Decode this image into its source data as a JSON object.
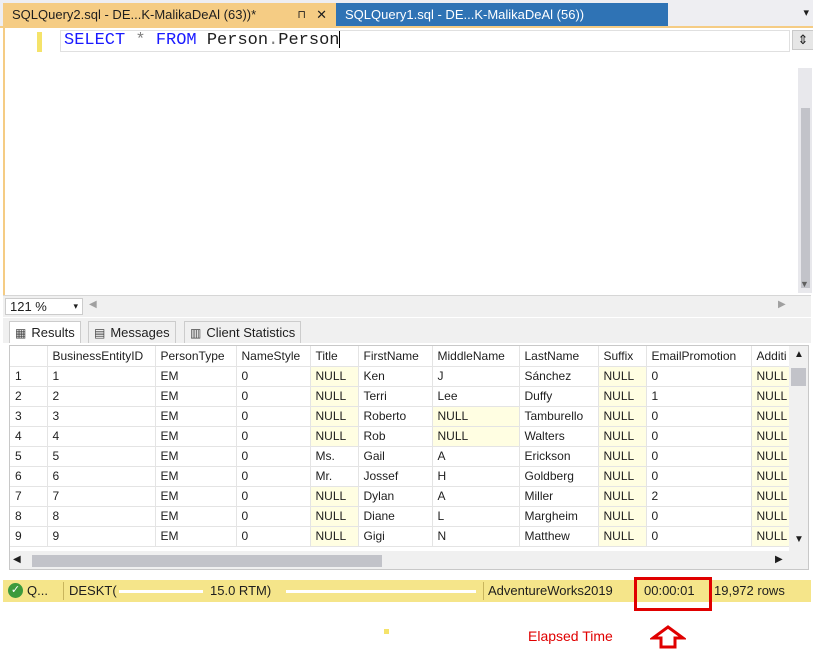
{
  "tabs": [
    {
      "label": "SQLQuery2.sql - DE...K-MalikaDeAl (63))*",
      "pin": "⊓",
      "close": "✕"
    },
    {
      "label": "SQLQuery1.sql - DE...K-MalikaDeAl (56))"
    }
  ],
  "tab_overflow": "▾",
  "editor": {
    "kw_select": "SELECT",
    "star": "*",
    "kw_from": "FROM",
    "table1": "Person",
    "dot": ".",
    "table2": "Person",
    "splitter": "⇕"
  },
  "zoom": {
    "value": "121 %",
    "dropdown": "▾"
  },
  "result_tabs": [
    {
      "label": "Results",
      "icon": "grid-icon"
    },
    {
      "label": "Messages",
      "icon": "messages-icon"
    },
    {
      "label": "Client Statistics",
      "icon": "statistics-icon"
    }
  ],
  "grid": {
    "columns": [
      "BusinessEntityID",
      "PersonType",
      "NameStyle",
      "Title",
      "FirstName",
      "MiddleName",
      "LastName",
      "Suffix",
      "EmailPromotion",
      "Additi"
    ],
    "rows": [
      [
        "1",
        "1",
        "EM",
        "0",
        "NULL",
        "Ken",
        "J",
        "Sánchez",
        "NULL",
        "0",
        "NULL"
      ],
      [
        "2",
        "2",
        "EM",
        "0",
        "NULL",
        "Terri",
        "Lee",
        "Duffy",
        "NULL",
        "1",
        "NULL"
      ],
      [
        "3",
        "3",
        "EM",
        "0",
        "NULL",
        "Roberto",
        "NULL",
        "Tamburello",
        "NULL",
        "0",
        "NULL"
      ],
      [
        "4",
        "4",
        "EM",
        "0",
        "NULL",
        "Rob",
        "NULL",
        "Walters",
        "NULL",
        "0",
        "NULL"
      ],
      [
        "5",
        "5",
        "EM",
        "0",
        "Ms.",
        "Gail",
        "A",
        "Erickson",
        "NULL",
        "0",
        "NULL"
      ],
      [
        "6",
        "6",
        "EM",
        "0",
        "Mr.",
        "Jossef",
        "H",
        "Goldberg",
        "NULL",
        "0",
        "NULL"
      ],
      [
        "7",
        "7",
        "EM",
        "0",
        "NULL",
        "Dylan",
        "A",
        "Miller",
        "NULL",
        "2",
        "NULL"
      ],
      [
        "8",
        "8",
        "EM",
        "0",
        "NULL",
        "Diane",
        "L",
        "Margheim",
        "NULL",
        "0",
        "NULL"
      ],
      [
        "9",
        "9",
        "EM",
        "0",
        "NULL",
        "Gigi",
        "N",
        "Matthew",
        "NULL",
        "0",
        "NULL"
      ]
    ]
  },
  "status": {
    "state": "Q...",
    "server": "DESKT(",
    "version": "15.0 RTM)",
    "database": "AdventureWorks2019",
    "elapsed": "00:00:01",
    "rows": "19,972 rows"
  },
  "annotation": {
    "label": "Elapsed Time"
  },
  "colors": {
    "active_tab": "#f5cc84",
    "inactive_tab": "#2f73b5",
    "status_bar": "#f5e58a",
    "null_cell": "#fffee2",
    "highlight": "#e00000",
    "keyword": "#1a1aff"
  }
}
